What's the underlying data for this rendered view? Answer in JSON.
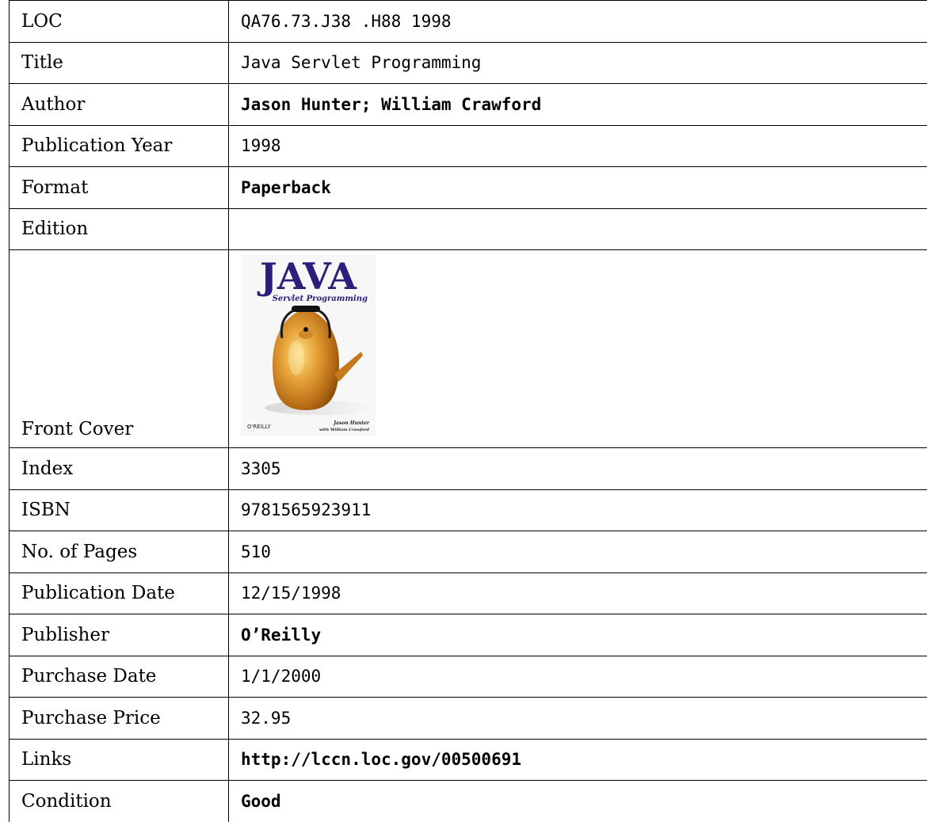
{
  "fields": {
    "loc": {
      "label": "LOC",
      "value": "QA76.73.J38 .H88 1998"
    },
    "title": {
      "label": "Title",
      "value": "Java Servlet Programming"
    },
    "author": {
      "label": "Author",
      "value": "Jason Hunter; William Crawford"
    },
    "publication_year": {
      "label": "Publication Year",
      "value": "1998"
    },
    "format": {
      "label": "Format",
      "value": "Paperback"
    },
    "edition": {
      "label": "Edition",
      "value": ""
    },
    "front_cover": {
      "label": "Front Cover"
    },
    "index": {
      "label": "Index",
      "value": "3305"
    },
    "isbn": {
      "label": "ISBN",
      "value": "9781565923911"
    },
    "pages": {
      "label": "No. of Pages",
      "value": "510"
    },
    "publication_date": {
      "label": "Publication Date",
      "value": "12/15/1998"
    },
    "publisher": {
      "label": "Publisher",
      "value": "O’Reilly"
    },
    "purchase_date": {
      "label": "Purchase Date",
      "value": "1/1/2000"
    },
    "purchase_price": {
      "label": "Purchase Price",
      "value": "32.95"
    },
    "links": {
      "label": "Links",
      "value": "http://lccn.loc.gov/00500691"
    },
    "condition": {
      "label": "Condition",
      "value": "Good"
    }
  },
  "cover": {
    "title": "JAVA",
    "subtitle": "Servlet Programming",
    "publisher": "O'REILLY",
    "author": "Jason Hunter",
    "coauthor": "with William Crawford"
  }
}
